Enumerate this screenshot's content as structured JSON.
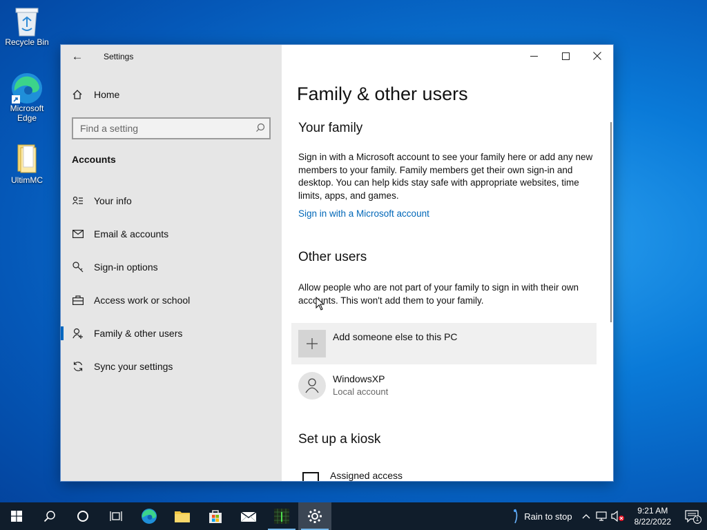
{
  "desktop": {
    "icons": [
      {
        "label": "Recycle Bin"
      },
      {
        "label": "Microsoft Edge"
      },
      {
        "label": "UltimMC"
      }
    ]
  },
  "window": {
    "app_title": "Settings",
    "nav": {
      "home_label": "Home",
      "search_placeholder": "Find a setting",
      "section_title": "Accounts",
      "items": [
        {
          "label": "Your info",
          "icon": "person-card-icon"
        },
        {
          "label": "Email & accounts",
          "icon": "mail-icon"
        },
        {
          "label": "Sign-in options",
          "icon": "key-icon"
        },
        {
          "label": "Access work or school",
          "icon": "briefcase-icon"
        },
        {
          "label": "Family & other users",
          "icon": "person-add-icon",
          "active": true
        },
        {
          "label": "Sync your settings",
          "icon": "sync-icon"
        }
      ]
    },
    "content": {
      "title": "Family & other users",
      "family": {
        "heading": "Your family",
        "description": "Sign in with a Microsoft account to see your family here or add any new members to your family. Family members get their own sign-in and desktop. You can help kids stay safe with appropriate websites, time limits, apps, and games.",
        "link": "Sign in with a Microsoft account"
      },
      "other_users": {
        "heading": "Other users",
        "description": "Allow people who are not part of your family to sign in with their own accounts. This won't add them to your family.",
        "add_label": "Add someone else to this PC",
        "users": [
          {
            "name": "WindowsXP",
            "type": "Local account"
          }
        ]
      },
      "kiosk": {
        "heading": "Set up a kiosk",
        "item_label": "Assigned access"
      }
    }
  },
  "taskbar": {
    "weather": "Rain to stop",
    "time": "9:21 AM",
    "date": "8/22/2022",
    "notification_count": "1"
  },
  "colors": {
    "accent": "#0067c0",
    "link": "#0067b8",
    "taskbar": "#101d2b"
  }
}
